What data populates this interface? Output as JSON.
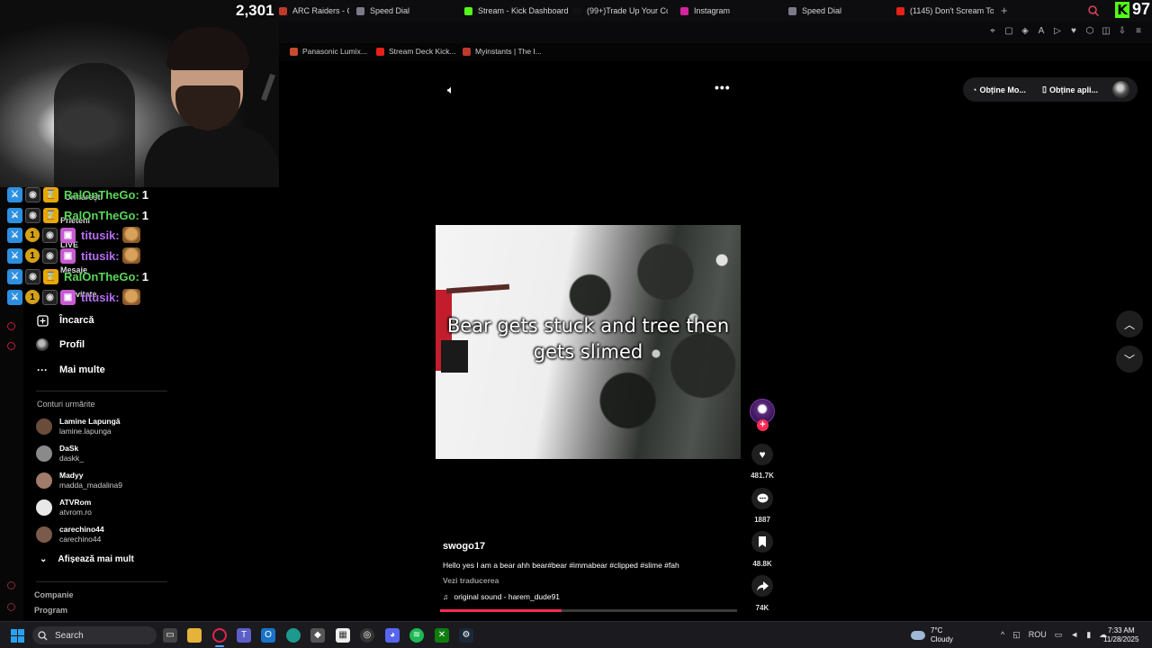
{
  "browser": {
    "tabs": [
      {
        "label": "ARC Raiders - Offi",
        "color": "#c0392b"
      },
      {
        "label": "Speed Dial",
        "color": "#7a7a8a"
      },
      {
        "label": "Stream - Kick Dashboard",
        "color": "#53fc18"
      },
      {
        "label": "(99+)Trade Up Your Cov",
        "color": "#111111"
      },
      {
        "label": "Instagram",
        "color": "#d6249f"
      },
      {
        "label": "Speed Dial",
        "color": "#7a7a8a"
      },
      {
        "label": "(1145) Don't Scream Toge",
        "color": "#e62117"
      }
    ],
    "kick_count": "97",
    "bookmarks": [
      {
        "label": "Panasonic Lumix...",
        "color": "#c94b2c"
      },
      {
        "label": "Stream Deck Kick...",
        "color": "#e62117"
      },
      {
        "label": "Myinstants | The I...",
        "color": "#c0392b"
      }
    ]
  },
  "stream": {
    "viewer_count": "2,301",
    "chat": [
      {
        "user": "RalOnTheGo:",
        "msg": "1",
        "user_color": "#5ad75a",
        "badges": [
          "mod",
          "cam",
          "hourglass"
        ],
        "emote": false
      },
      {
        "user": "RalOnTheGo:",
        "msg": "1",
        "user_color": "#5ad75a",
        "badges": [
          "mod",
          "cam",
          "hourglass"
        ],
        "emote": false
      },
      {
        "user": "titusik:",
        "msg": "",
        "user_color": "#b46cf0",
        "badges": [
          "mod",
          "num",
          "cam",
          "gift"
        ],
        "emote": true
      },
      {
        "user": "titusik:",
        "msg": "",
        "user_color": "#b46cf0",
        "badges": [
          "mod",
          "num",
          "cam",
          "gift"
        ],
        "emote": true
      },
      {
        "user": "RalOnTheGo:",
        "msg": "1",
        "user_color": "#5ad75a",
        "badges": [
          "mod",
          "cam",
          "hourglass"
        ],
        "emote": false
      },
      {
        "user": "titusik:",
        "msg": "",
        "user_color": "#b46cf0",
        "badges": [
          "mod",
          "num",
          "cam",
          "gift"
        ],
        "emote": true
      }
    ]
  },
  "sidebar": {
    "hidden_items": [
      "Urmărești",
      "Prieteni",
      "LIVE",
      "Mesaje",
      "Activitate"
    ],
    "nav": [
      {
        "label": "Încarcă",
        "icon": "upload-icon"
      },
      {
        "label": "Profil",
        "icon": "profile-avatar"
      },
      {
        "label": "Mai multe",
        "icon": "more-icon"
      }
    ],
    "followed_title": "Conturi urmărite",
    "accounts": [
      {
        "name": "Lamine Lapungă",
        "username": "lamine.lapunga",
        "color": "#6a4c3a"
      },
      {
        "name": "DaSk",
        "username": "daskk_",
        "color": "#8a8a8a"
      },
      {
        "name": "Madyy",
        "username": "madda_madalina9",
        "color": "#a07a6a"
      },
      {
        "name": "ATVRom",
        "username": "atvrom.ro",
        "color": "#e8e8e8"
      },
      {
        "name": "carechino44",
        "username": "carechino44",
        "color": "#7a5a4a"
      }
    ],
    "show_more": "Afișează mai mult",
    "footer": [
      "Companie",
      "Program"
    ]
  },
  "video": {
    "caption": "Bear gets stuck and tree then gets slimed",
    "author": "swogo17",
    "description": "Hello yes I am a bear ahh bear#bear #immabear #clipped #slime #fah",
    "translate_label": "Vezi traducerea",
    "sound": "original sound - harem_dude91",
    "progress": 0.41,
    "likes": "481.7K",
    "comments": "1887",
    "saves": "48.8K",
    "shares": "74K"
  },
  "header_actions": {
    "get_coins": "Obține Mo...",
    "get_app": "Obține apli..."
  },
  "taskbar": {
    "search_placeholder": "Search",
    "weather_temp": "7°C",
    "weather_desc": "Cloudy",
    "lang": "ROU",
    "time": "7:33 AM",
    "date": "11/28/2025"
  }
}
